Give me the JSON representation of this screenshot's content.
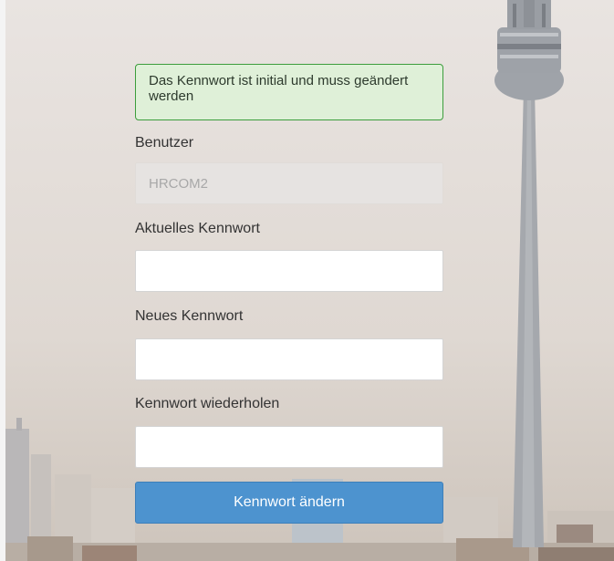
{
  "alert": {
    "message": "Das Kennwort ist initial und muss geändert werden"
  },
  "form": {
    "user_label": "Benutzer",
    "user_value": "HRCOM2",
    "current_password_label": "Aktuelles Kennwort",
    "new_password_label": "Neues Kennwort",
    "repeat_password_label": "Kennwort wiederholen",
    "submit_label": "Kennwort ändern"
  },
  "colors": {
    "alert_background": "#dff0d8",
    "alert_border": "#3c9d3c",
    "button_background": "#4d93cf"
  },
  "background": {
    "scene": "city skyline with television tower"
  }
}
